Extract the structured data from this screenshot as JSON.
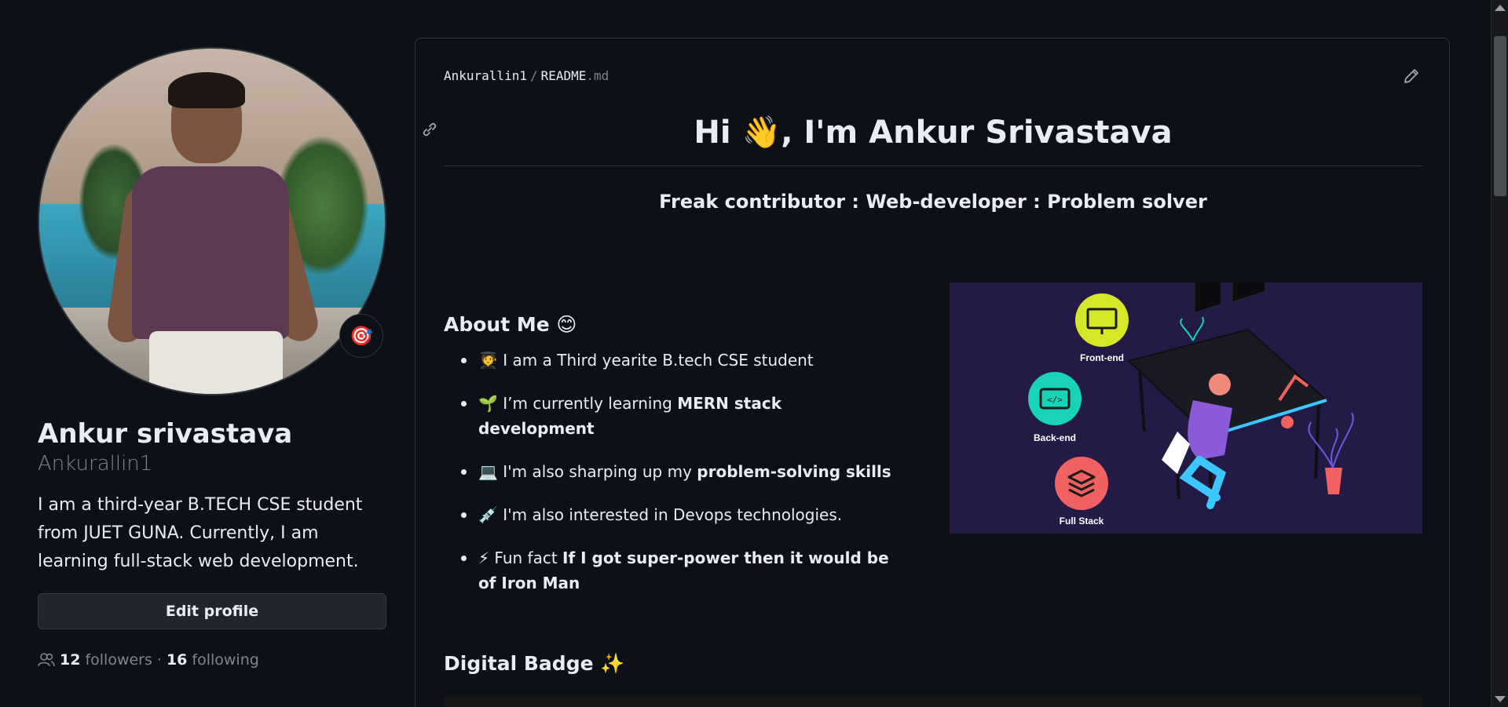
{
  "profile": {
    "name": "Ankur srivastava",
    "username": "Ankurallin1",
    "bio": "I am a third-year B.TECH CSE student from JUET GUNA. Currently, I am learning full-stack web development.",
    "edit_button": "Edit profile",
    "status_emoji": "🎯",
    "followers_count": "12",
    "followers_label": "followers",
    "separator": "·",
    "following_count": "16",
    "following_label": "following"
  },
  "readme": {
    "crumb_user": "Ankurallin1",
    "crumb_sep": "/",
    "crumb_file": "README",
    "crumb_ext": ".md",
    "title": "Hi 👋, I'm Ankur Srivastava",
    "tagline": "Freak contributor : Web-developer : Problem solver",
    "about_heading": "About Me 😊",
    "about_items": [
      {
        "emoji": "🧑‍🎓",
        "text": "I am a Third yearite B.tech CSE student",
        "bold": ""
      },
      {
        "emoji": "🌱",
        "text": "I’m currently learning",
        "bold": "MERN stack development"
      },
      {
        "emoji": "💻",
        "text": "I'm also sharping up my",
        "bold": "problem-solving skills"
      },
      {
        "emoji": "💉",
        "text": "I'm also interested in Devops technologies.",
        "bold": ""
      },
      {
        "emoji": "⚡",
        "text": "Fun fact",
        "bold": "If I got super-power then it would be of Iron Man"
      }
    ],
    "hero": {
      "frontend_label": "Front-end",
      "backend_label": "Back-end",
      "fullstack_label": "Full Stack",
      "colors": {
        "bg": "#231b45",
        "frontend": "#d6e629",
        "backend": "#19d3b6",
        "fullstack": "#f26161"
      }
    },
    "badge_heading": "Digital Badge ✨"
  }
}
